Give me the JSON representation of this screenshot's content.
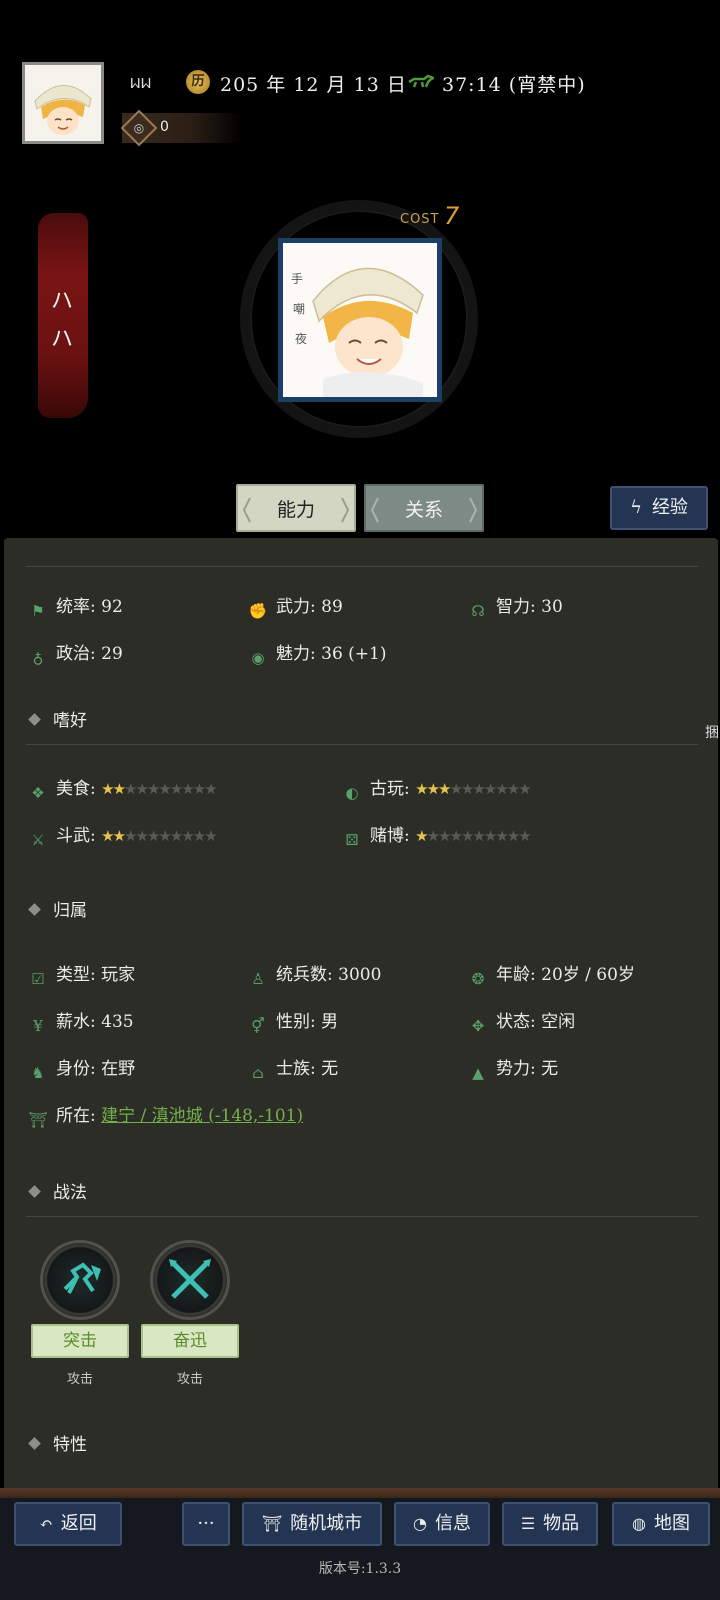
{
  "header": {
    "player_name": "ᥕᥕ",
    "date": "205 年 12 月 13 日",
    "time": "37:14 (宵禁中)",
    "coins": "0"
  },
  "hero": {
    "banner_text": [
      "ハ",
      "ハ"
    ],
    "cost_label": "COST",
    "cost_value": "7"
  },
  "tabs": {
    "ability": "能力",
    "relation": "关系",
    "experience": "经验"
  },
  "stats": [
    {
      "icon": "flag-icon",
      "label": "统率",
      "value": "92"
    },
    {
      "icon": "arm-icon",
      "label": "武力",
      "value": "89"
    },
    {
      "icon": "brain-icon",
      "label": "智力",
      "value": "30"
    },
    {
      "icon": "bag-icon",
      "label": "政治",
      "value": "29"
    },
    {
      "icon": "eye-icon",
      "label": "魅力",
      "value": "36 (+1)"
    }
  ],
  "hobbies": {
    "title": "嗜好",
    "items": [
      {
        "icon": "candy-icon",
        "label": "美食",
        "stars": 2
      },
      {
        "icon": "antique-icon",
        "label": "古玩",
        "stars": 3
      },
      {
        "icon": "swords-icon",
        "label": "斗武",
        "stars": 2
      },
      {
        "icon": "dice-icon",
        "label": "赌博",
        "stars": 1
      }
    ],
    "max_stars": 10,
    "side_text": "捆"
  },
  "affiliation": {
    "title": "归属",
    "rows": [
      {
        "icon": "calendar-check-icon",
        "label": "类型",
        "value": "玩家"
      },
      {
        "icon": "soldier-icon",
        "label": "统兵数",
        "value": "3000"
      },
      {
        "icon": "age-icon",
        "label": "年龄",
        "value": "20岁 / 60岁"
      },
      {
        "icon": "yen-icon",
        "label": "薪水",
        "value": "435"
      },
      {
        "icon": "gender-icon",
        "label": "性别",
        "value": "男"
      },
      {
        "icon": "status-icon",
        "label": "状态",
        "value": "空闲"
      },
      {
        "icon": "identity-icon",
        "label": "身份",
        "value": "在野"
      },
      {
        "icon": "clan-icon",
        "label": "士族",
        "value": "无"
      },
      {
        "icon": "faction-icon",
        "label": "势力",
        "value": "无"
      }
    ],
    "location_label": "所在",
    "location_value": "建宁 / 滇池城 (-148,-101)"
  },
  "tactics": {
    "title": "战法",
    "items": [
      {
        "name": "突击",
        "type": "攻击"
      },
      {
        "name": "奋迅",
        "type": "攻击"
      }
    ]
  },
  "traits": {
    "title": "特性"
  },
  "bottom": {
    "back": "返回",
    "more": "···",
    "random_city": "随机城市",
    "info": "信息",
    "items": "物品",
    "map": "地图",
    "version": "版本号:1.3.3"
  }
}
